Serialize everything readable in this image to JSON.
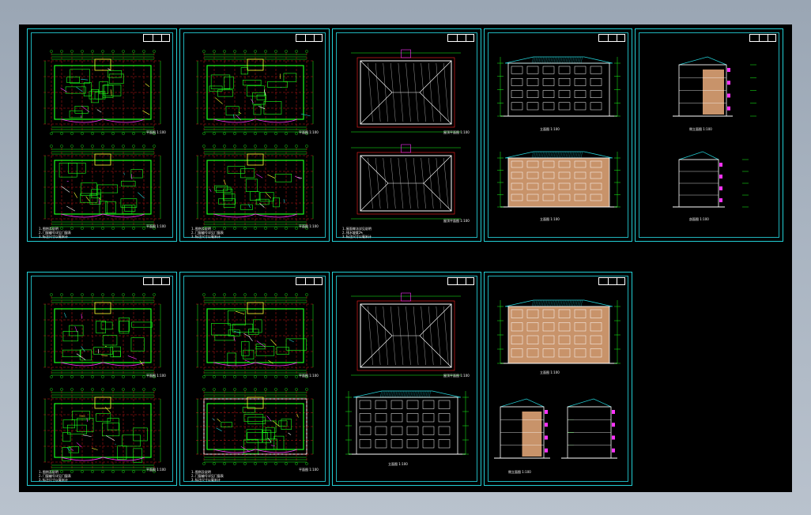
{
  "viewer": {
    "background_color": "#000000",
    "frame_color": "#23d0d6",
    "plan_line_color": "#19ff19",
    "axis_color": "#ff2020",
    "text_color": "#ffffff"
  },
  "sheets": [
    {
      "id": "s1",
      "kind": "plan",
      "note_lines": [
        "1.图例及说明",
        "2.门窗编号详见门窗表",
        "3.标注尺寸以毫米计"
      ],
      "caption": "平面图  1:100",
      "caption2": "平面图  1:100"
    },
    {
      "id": "s2",
      "kind": "plan",
      "note_lines": [
        "1.图例及说明",
        "2.门窗编号详见门窗表",
        "3.标注尺寸以毫米计"
      ],
      "caption": "平面图  1:100",
      "caption2": "平面图  1:100"
    },
    {
      "id": "s3",
      "kind": "roof",
      "note_lines": [
        "1.屋面做法详见说明",
        "2.排水坡度2%",
        "3.标注尺寸以毫米计"
      ],
      "caption": "屋顶平面图  1:100",
      "caption2": "屋顶平面图  1:100"
    },
    {
      "id": "s4",
      "kind": "elevation",
      "caption": "立面图  1:100",
      "caption2": "立面图  1:100"
    },
    {
      "id": "s5",
      "kind": "section",
      "caption": "侧立面图  1:100",
      "caption2": "剖面图  1:100"
    },
    {
      "id": "s6",
      "kind": "plan",
      "note_lines": [
        "1.图例及说明",
        "2.门窗编号详见门窗表",
        "3.标注尺寸以毫米计"
      ],
      "caption": "平面图  1:100",
      "caption2": "平面图  1:100"
    },
    {
      "id": "s7",
      "kind": "plan",
      "note_lines": [
        "1.图例及说明",
        "2.门窗编号详见门窗表",
        "3.标注尺寸以毫米计"
      ],
      "caption": "平面图  1:100",
      "caption2": "平面图  1:100"
    },
    {
      "id": "s8",
      "kind": "roof-elev",
      "caption": "屋顶平面图  1:100",
      "caption2": "立面图  1:100"
    },
    {
      "id": "s9",
      "kind": "elev-side",
      "caption": "立面图  1:100",
      "caption2": "侧立面图  1:100"
    }
  ]
}
